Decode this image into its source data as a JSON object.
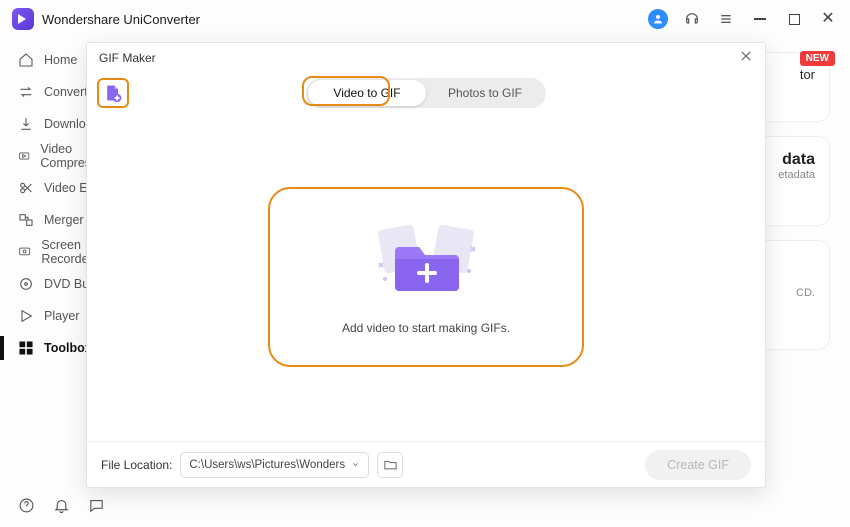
{
  "app": {
    "title": "Wondershare UniConverter"
  },
  "sidebar": {
    "items": [
      {
        "label": "Home"
      },
      {
        "label": "Converter"
      },
      {
        "label": "Downloader"
      },
      {
        "label": "Video Compressor"
      },
      {
        "label": "Video Editor"
      },
      {
        "label": "Merger"
      },
      {
        "label": "Screen Recorder"
      },
      {
        "label": "DVD Burner"
      },
      {
        "label": "Player"
      },
      {
        "label": "Toolbox"
      }
    ]
  },
  "bg_panels": {
    "new_label": "NEW",
    "p1_text": "tor",
    "p2_title": "data",
    "p2_sub": "etadata",
    "p3_sub": "CD."
  },
  "dialog": {
    "title": "GIF Maker",
    "tab_video": "Video to GIF",
    "tab_photo": "Photos to GIF",
    "drop_text": "Add video to start making GIFs.",
    "file_location_label": "File Location:",
    "file_location_value": "C:\\Users\\ws\\Pictures\\Wonders",
    "create_label": "Create GIF"
  }
}
